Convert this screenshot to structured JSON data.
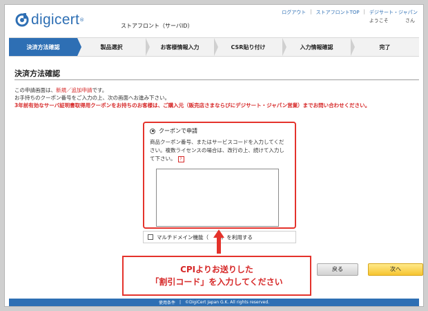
{
  "header": {
    "logo_text": "digicert",
    "logo_tm": "®",
    "storefront": "ストアフロント（サーバID）",
    "links": [
      "ログアウト",
      "ストアフロントTOP",
      "デジサート・ジャパン"
    ],
    "welcome": "ようこそ",
    "honorific": "さん"
  },
  "steps": [
    {
      "label": "決済方法確認",
      "active": true
    },
    {
      "label": "製品選択"
    },
    {
      "label": "お客様情報入力"
    },
    {
      "label": "CSR貼り付け"
    },
    {
      "label": "入力情報確認"
    },
    {
      "label": "完了"
    }
  ],
  "page_title": "決済方法確認",
  "info": {
    "line1_pre": "この申請画面は、",
    "line1_red": "新規／追加申請",
    "line1_post": "です。",
    "line2": "お手持ちのクーポン番号をご入力の上、次の画面へお進み下さい。",
    "line3": "3年前有効なサーバ証明書取得用クーポンをお持ちのお客様は、ご購入元（販売店さまならびにデジサート・ジャパン営業）までお問い合わせください。"
  },
  "coupon": {
    "radio_label": "クーポンで申請",
    "description": "商品クーポン番号、またはサービスコードを入力してください。複数ライセンスの場合は、改行の上、続けて入力して下さい。",
    "help": "?",
    "textarea_value": ""
  },
  "multidomain": {
    "label": "マルチドメイン機能（　　s）を利用する"
  },
  "callout": {
    "line1": "CPIよりお送りした",
    "line2": "「割引コード」を入力してください"
  },
  "buttons": {
    "back": "戻る",
    "next": "次へ"
  },
  "footer": {
    "terms": "使用条件",
    "sep": "|",
    "copyright": "©DigiCert Japan G.K. All rights reserved."
  },
  "colors": {
    "brand": "#2e6fb4",
    "alert": "#e4322b",
    "next_button": "#f6c531"
  }
}
